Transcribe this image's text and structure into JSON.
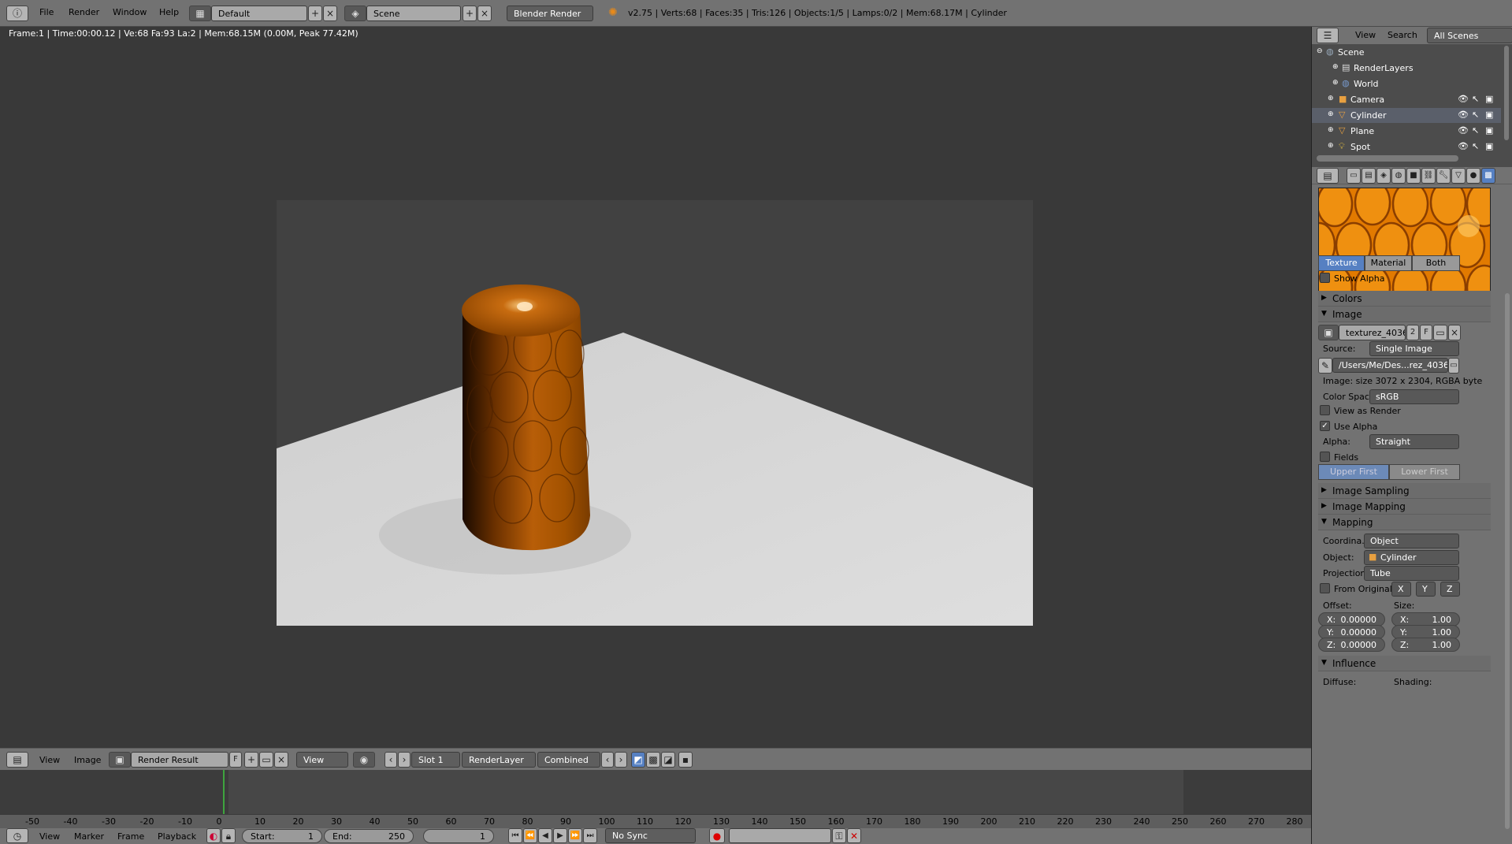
{
  "topbar": {
    "menus": [
      "File",
      "Render",
      "Window",
      "Help"
    ],
    "layout": "Default",
    "scene": "Scene",
    "engine": "Blender Render",
    "stats": "v2.75 | Verts:68 | Faces:35 | Tris:126 | Objects:1/5 | Lamps:0/2 | Mem:68.17M | Cylinder"
  },
  "viewport": {
    "info": "Frame:1 | Time:00:00.12 | Ve:68 Fa:93 La:2 | Mem:68.15M (0.00M, Peak 77.42M)"
  },
  "image_header": {
    "view_menu": "View",
    "image_menu": "Image",
    "image_name": "Render Result",
    "fake_user": "F",
    "view_select": "View",
    "slot": "Slot 1",
    "layer": "RenderLayer",
    "pass": "Combined"
  },
  "timeline": {
    "ticks": [
      "-50",
      "-40",
      "-30",
      "-20",
      "-10",
      "0",
      "10",
      "20",
      "30",
      "40",
      "50",
      "60",
      "70",
      "80",
      "90",
      "100",
      "110",
      "120",
      "130",
      "140",
      "150",
      "160",
      "170",
      "180",
      "190",
      "200",
      "210",
      "220",
      "230",
      "240",
      "250",
      "260",
      "270",
      "280"
    ],
    "current_frame_label": "1",
    "menus": [
      "View",
      "Marker",
      "Frame",
      "Playback"
    ],
    "start_label": "Start:",
    "start": "1",
    "end_label": "End:",
    "end": "250",
    "frame": "1",
    "sync": "No Sync"
  },
  "outliner": {
    "menus": [
      "View",
      "Search"
    ],
    "filter": "All Scenes",
    "items": [
      {
        "label": "Scene",
        "indent": 0
      },
      {
        "label": "RenderLayers",
        "indent": 1
      },
      {
        "label": "World",
        "indent": 1
      },
      {
        "label": "Camera",
        "indent": 1
      },
      {
        "label": "Cylinder",
        "indent": 1
      },
      {
        "label": "Plane",
        "indent": 1
      },
      {
        "label": "Spot",
        "indent": 1
      }
    ]
  },
  "properties": {
    "tabs": [
      "Texture",
      "Material",
      "Both"
    ],
    "show_alpha": "Show Alpha",
    "colors": "Colors",
    "image_section": "Image",
    "image_name": "texturez_4036.p...",
    "image_users": "2",
    "image_fake": "F",
    "source_label": "Source:",
    "source": "Single Image",
    "path": "/Users/Me/Des...rez_4036.png",
    "image_info": "Image: size 3072 x 2304, RGBA byte",
    "color_space_label": "Color Space:",
    "color_space": "sRGB",
    "view_as_render": "View as Render",
    "use_alpha": "Use Alpha",
    "alpha_label": "Alpha:",
    "alpha": "Straight",
    "fields": "Fields",
    "upper_first": "Upper First",
    "lower_first": "Lower First",
    "image_sampling": "Image Sampling",
    "image_mapping": "Image Mapping",
    "mapping": "Mapping",
    "coord_label": "Coordina...",
    "coord": "Object",
    "object_label": "Object:",
    "object": "Cylinder",
    "projection_label": "Projection:",
    "projection": "Tube",
    "from_original": "From Original",
    "axis_x": "X",
    "axis_y": "Y",
    "axis_z": "Z",
    "offset_label": "Offset:",
    "size_label": "Size:",
    "offset_x": "X:",
    "offset_x_val": "0.00000",
    "offset_y": "Y:",
    "offset_y_val": "0.00000",
    "offset_z": "Z:",
    "offset_z_val": "0.00000",
    "size_x": "X:",
    "size_x_val": "1.00",
    "size_y": "Y:",
    "size_y_val": "1.00",
    "size_z": "Z:",
    "size_z_val": "1.00",
    "influence": "Influence",
    "diffuse_label": "Diffuse:",
    "shading_label": "Shading:"
  },
  "colors": {
    "accent_blue": "#5680c2",
    "selected_row": "#5a5f6a",
    "texture_orange": "#e07800",
    "current_frame_green": "#3ea43e"
  }
}
